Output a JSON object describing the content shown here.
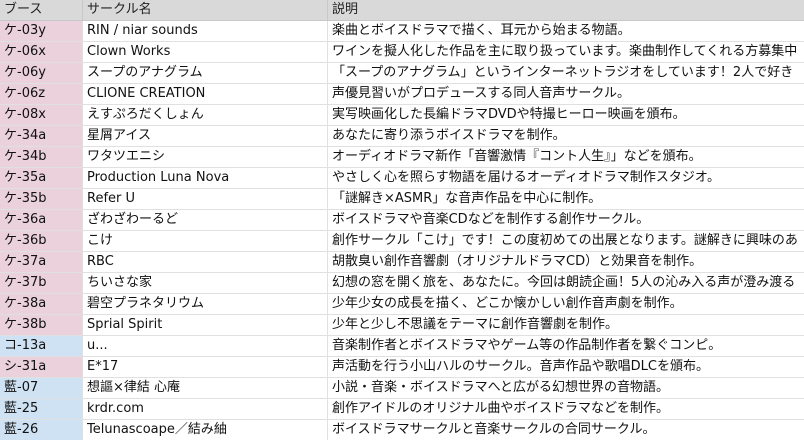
{
  "colors": {
    "header": "#d9d9d9",
    "booth_ke": "#ead1dc",
    "booth_ko_ai": "#cfe2f3",
    "booth_shi": "#ead1dc"
  },
  "header": {
    "booth": "ブース",
    "circle": "サークル名",
    "desc": "説明"
  },
  "rows": [
    {
      "booth": "ケ-03y",
      "circle": "RIN / niar sounds",
      "desc": "楽曲とボイスドラマで描く、耳元から始まる物語。",
      "color": "pink"
    },
    {
      "booth": "ケ-06x",
      "circle": "Clown Works",
      "desc": "ワインを擬人化した作品を主に取り扱っています。楽曲制作してくれる方募集中",
      "color": "pink"
    },
    {
      "booth": "ケ-06y",
      "circle": "スープのアナグラム",
      "desc": "「スープのアナグラム」というインターネットラジオをしています！2人で好き",
      "color": "pink"
    },
    {
      "booth": "ケ-06z",
      "circle": "CLIONE CREATION",
      "desc": "声優見習いがプロデュースする同人音声サークル。",
      "color": "pink"
    },
    {
      "booth": "ケ-08x",
      "circle": "えすぷろだくしょん",
      "desc": "実写映画化した長編ドラマDVDや特撮ヒーロー映画を頒布。",
      "color": "pink"
    },
    {
      "booth": "ケ-34a",
      "circle": "星屑アイス",
      "desc": "あなたに寄り添うボイスドラマを制作。",
      "color": "pink"
    },
    {
      "booth": "ケ-34b",
      "circle": "ワタツエニシ",
      "desc": "オーディオドラマ新作「音響激情『コント人生』」などを頒布。",
      "color": "pink"
    },
    {
      "booth": "ケ-35a",
      "circle": "Production Luna Nova",
      "desc": "やさしく心を照らす物語を届けるオーディオドラマ制作スタジオ。",
      "color": "pink"
    },
    {
      "booth": "ケ-35b",
      "circle": "Refer U",
      "desc": "「謎解き×ASMR」な音声作品を中心に制作。",
      "color": "pink"
    },
    {
      "booth": "ケ-36a",
      "circle": "ざわざわーるど",
      "desc": "ボイスドラマや音楽CDなどを制作する創作サークル。",
      "color": "pink"
    },
    {
      "booth": "ケ-36b",
      "circle": "こけ",
      "desc": "創作サークル「こけ」です！この度初めての出展となります。謎解きに興味のあ",
      "color": "pink"
    },
    {
      "booth": "ケ-37a",
      "circle": "RBC",
      "desc": "胡散臭い創作音響劇（オリジナルドラマCD）と効果音を制作。",
      "color": "pink"
    },
    {
      "booth": "ケ-37b",
      "circle": "ちいさな家",
      "desc": "幻想の窓を開く旅を、あなたに。今回は朗読企画！5人の沁み入る声が澄み渡る",
      "color": "pink"
    },
    {
      "booth": "ケ-38a",
      "circle": "碧空プラネタリウム",
      "desc": "少年少女の成長を描く、どこか懐かしい創作音声劇を制作。",
      "color": "pink"
    },
    {
      "booth": "ケ-38b",
      "circle": "Sprial Spirit",
      "desc": "少年と少し不思議をテーマに創作音響劇を制作。",
      "color": "pink"
    },
    {
      "booth": "コ-13a",
      "circle": "u...",
      "desc": "音楽制作者とボイスドラマやゲーム等の作品制作者を繋ぐコンピ。",
      "color": "blue"
    },
    {
      "booth": "シ-31a",
      "circle": "E*17",
      "desc": "声活動を行う小山ハルのサークル。音声作品や歌唱DLCを頒布。",
      "color": "pink"
    },
    {
      "booth": "藍-07",
      "circle": "想謳×律結 心庵",
      "desc": "小説・音楽・ボイスドラマへと広がる幻想世界の音物語。",
      "color": "blue"
    },
    {
      "booth": "藍-25",
      "circle": "krdr.com",
      "desc": "創作アイドルのオリジナル曲やボイスドラマなどを制作。",
      "color": "blue"
    },
    {
      "booth": "藍-26",
      "circle": "Telunascoape／結み紬",
      "desc": "ボイスドラマサークルと音楽サークルの合同サークル。",
      "color": "blue"
    }
  ]
}
